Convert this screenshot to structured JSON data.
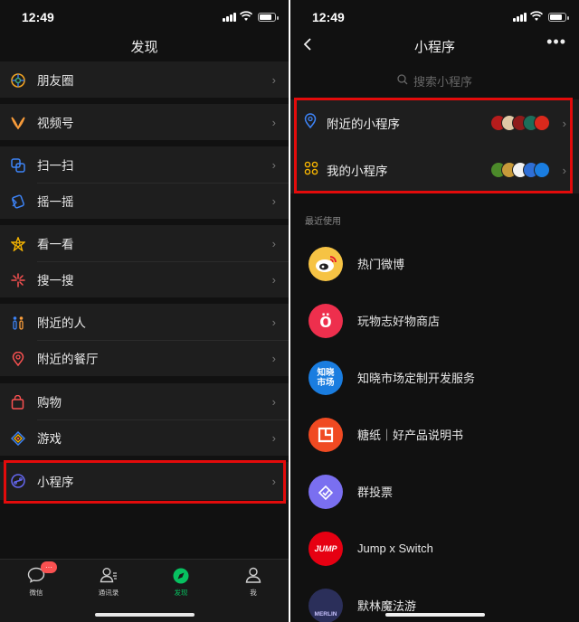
{
  "left": {
    "status_time": "12:49",
    "title": "发现",
    "menu": [
      {
        "label": "朋友圈",
        "icon": "moments-icon",
        "color": "#f5a623"
      },
      {
        "label": "视频号",
        "icon": "channels-icon",
        "color": "#fa9d3b"
      },
      {
        "label": "扫一扫",
        "icon": "scan-icon",
        "color": "#3d83f6"
      },
      {
        "label": "摇一摇",
        "icon": "shake-icon",
        "color": "#3d83f6"
      },
      {
        "label": "看一看",
        "icon": "top-stories-icon",
        "color": "#f7b500"
      },
      {
        "label": "搜一搜",
        "icon": "search-icon",
        "color": "#fa5151"
      },
      {
        "label": "附近的人",
        "icon": "people-nearby-icon",
        "color": "#3d83f6"
      },
      {
        "label": "附近的餐厅",
        "icon": "location-pin-icon",
        "color": "#fa5151"
      },
      {
        "label": "购物",
        "icon": "shopping-bag-icon",
        "color": "#fa5151"
      },
      {
        "label": "游戏",
        "icon": "games-icon",
        "color": "#3d83f6"
      },
      {
        "label": "小程序",
        "icon": "mini-program-icon",
        "color": "#6467f0"
      }
    ],
    "tabs": [
      {
        "label": "微信",
        "icon": "chats-icon",
        "badge": "···"
      },
      {
        "label": "通讯录",
        "icon": "contacts-icon"
      },
      {
        "label": "发现",
        "icon": "discover-icon",
        "active": true
      },
      {
        "label": "我",
        "icon": "me-icon"
      }
    ]
  },
  "right": {
    "status_time": "12:49",
    "title": "小程序",
    "search_placeholder": "搜索小程序",
    "nearby_label": "附近的小程序",
    "mine_label": "我的小程序",
    "recent_label": "最近使用",
    "apps": [
      {
        "name": "热门微博",
        "icon": "weibo-icon",
        "bg": "#f6c344"
      },
      {
        "name": "玩物志好物商店",
        "icon": "wanwuzhi-icon",
        "bg": "#ee2f4d",
        "glyph": "ö"
      },
      {
        "name": "知晓市场定制开发服务",
        "icon": "zhixiao-icon",
        "bg": "#1a7de0",
        "glyph": "知晓市场"
      },
      {
        "name": "糖纸｜好产品说明书",
        "icon": "tangzhi-icon",
        "bg": "#f04a22"
      },
      {
        "name": "群投票",
        "icon": "group-vote-icon",
        "bg": "#7a6ff0"
      },
      {
        "name": "Jump x Switch",
        "icon": "jump-switch-icon",
        "bg": "#e60012",
        "glyph": "JUMP"
      },
      {
        "name": "默林魔法游",
        "icon": "merlin-icon",
        "bg": "#2b2f5a",
        "glyph": "MERLIN"
      }
    ]
  }
}
